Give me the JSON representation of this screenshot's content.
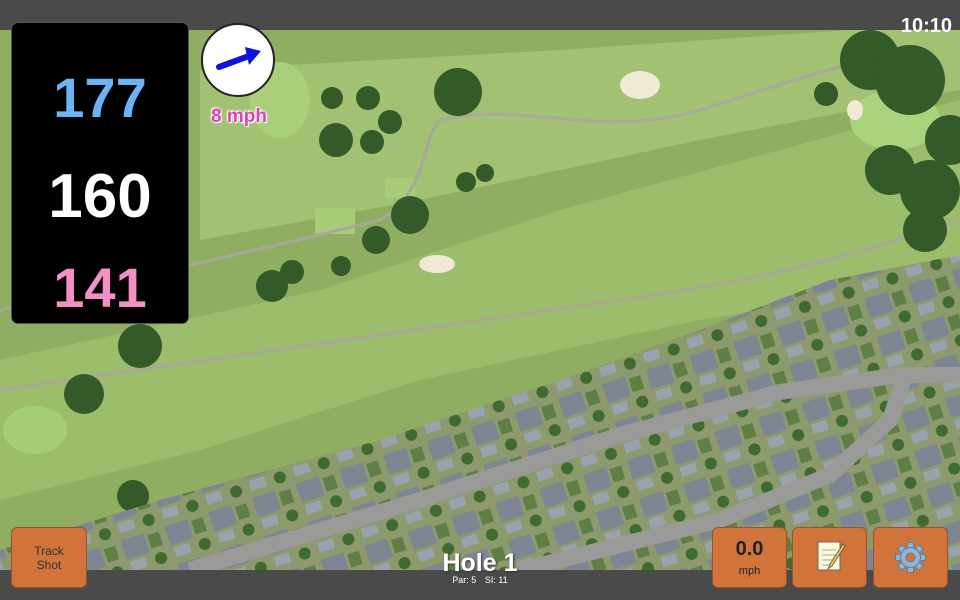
{
  "status_bar": {
    "time": "10:10"
  },
  "distances": {
    "back": "177",
    "center": "160",
    "front": "141"
  },
  "colors": {
    "back": "#6bb4f4",
    "center": "#ffffff",
    "front": "#f28fc5",
    "button": "#d0743c",
    "wind_label": "#e03fba"
  },
  "wind": {
    "speed_label": "8 mph",
    "icon": "arrow-right-icon"
  },
  "hole": {
    "title": "Hole 1",
    "par_label": "Par: 5",
    "si_label": "SI: 11"
  },
  "buttons": {
    "track_shot": {
      "line1": "Track",
      "line2": "Shot"
    },
    "speed": {
      "value": "0.0",
      "unit": "mph"
    },
    "notes": {
      "icon": "notepad-icon"
    },
    "settings": {
      "icon": "gear-icon"
    }
  }
}
